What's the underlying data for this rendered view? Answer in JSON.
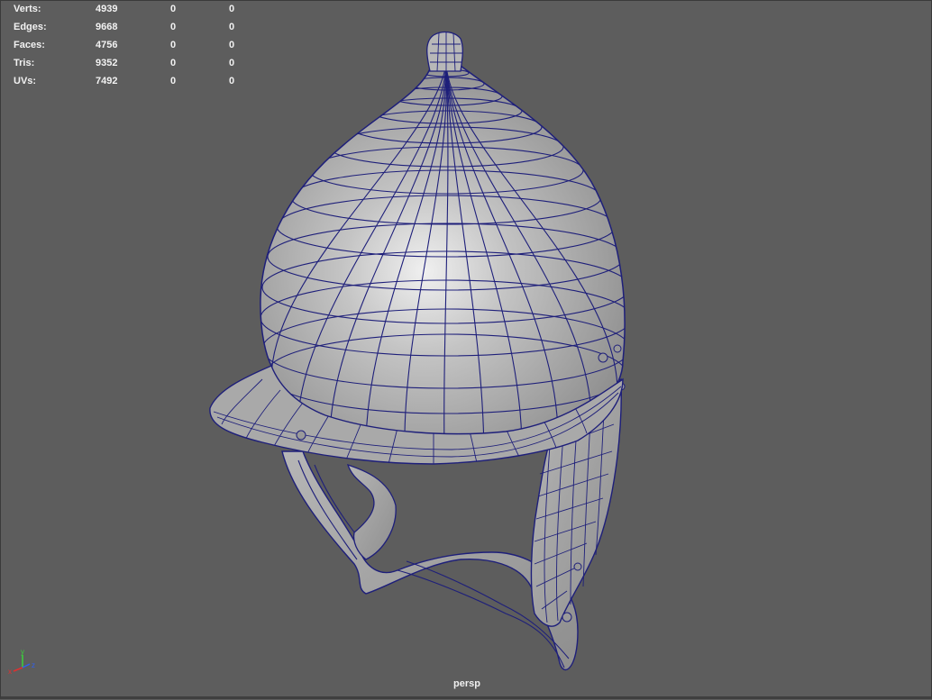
{
  "hud": {
    "rows": [
      {
        "label": "Verts:",
        "v1": "4939",
        "v2": "0",
        "v3": "0"
      },
      {
        "label": "Edges:",
        "v1": "9668",
        "v2": "0",
        "v3": "0"
      },
      {
        "label": "Faces:",
        "v1": "4756",
        "v2": "0",
        "v3": "0"
      },
      {
        "label": "Tris:",
        "v1": "9352",
        "v2": "0",
        "v3": "0"
      },
      {
        "label": "UVs:",
        "v1": "7492",
        "v2": "0",
        "v3": "0"
      }
    ]
  },
  "viewport": {
    "camera": "persp",
    "object": "helmet-wireframe-model",
    "wire_color": "#1e1f7a",
    "background": "#5d5d5d"
  },
  "axis": {
    "x": "x",
    "y": "y",
    "z": "z"
  }
}
